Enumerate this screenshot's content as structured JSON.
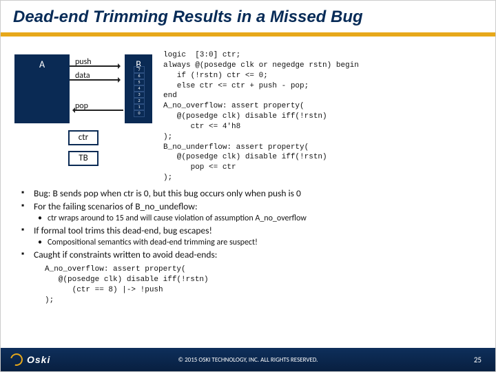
{
  "title": "Dead-end Trimming Results in a Missed Bug",
  "diagram": {
    "blockA": "A",
    "blockB": "B",
    "push": "push",
    "data": "data",
    "pop": "pop",
    "ctr": "ctr",
    "tb": "TB",
    "stack": [
      "7",
      "6",
      "5",
      "4",
      "3",
      "2",
      "1",
      "0"
    ]
  },
  "code_main": "logic  [3:0] ctr;\nalways @(posedge clk or negedge rstn) begin\n   if (!rstn) ctr <= 0;\n   else ctr <= ctr + push - pop;\nend\nA_no_overflow: assert property(\n   @(posedge clk) disable iff(!rstn)\n      ctr <= 4'h8\n);\nB_no_underflow: assert property(\n   @(posedge clk) disable iff(!rstn)\n      pop <= ctr\n);",
  "bullets": {
    "b1": "Bug: B sends pop when ctr is 0, but this bug occurs only when push is 0",
    "b2": "For the failing scenarios of B_no_undeflow:",
    "b2a": "ctr wraps around to 15 and will cause violation of assumption A_no_overflow",
    "b3": "If formal tool trims this dead-end, bug escapes!",
    "b3a": "Compositional semantics with dead-end trimming are suspect!",
    "b4": "Caught if constraints written to avoid dead-ends:"
  },
  "code_bottom": "A_no_overflow: assert property(\n   @(posedge clk) disable iff(!rstn)\n      (ctr == 8) |-> !push\n);",
  "footer": {
    "brand": "Oski",
    "copyright": "© 2015 OSKI TECHNOLOGY, INC.  ALL RIGHTS RESERVED.",
    "page": "25"
  }
}
